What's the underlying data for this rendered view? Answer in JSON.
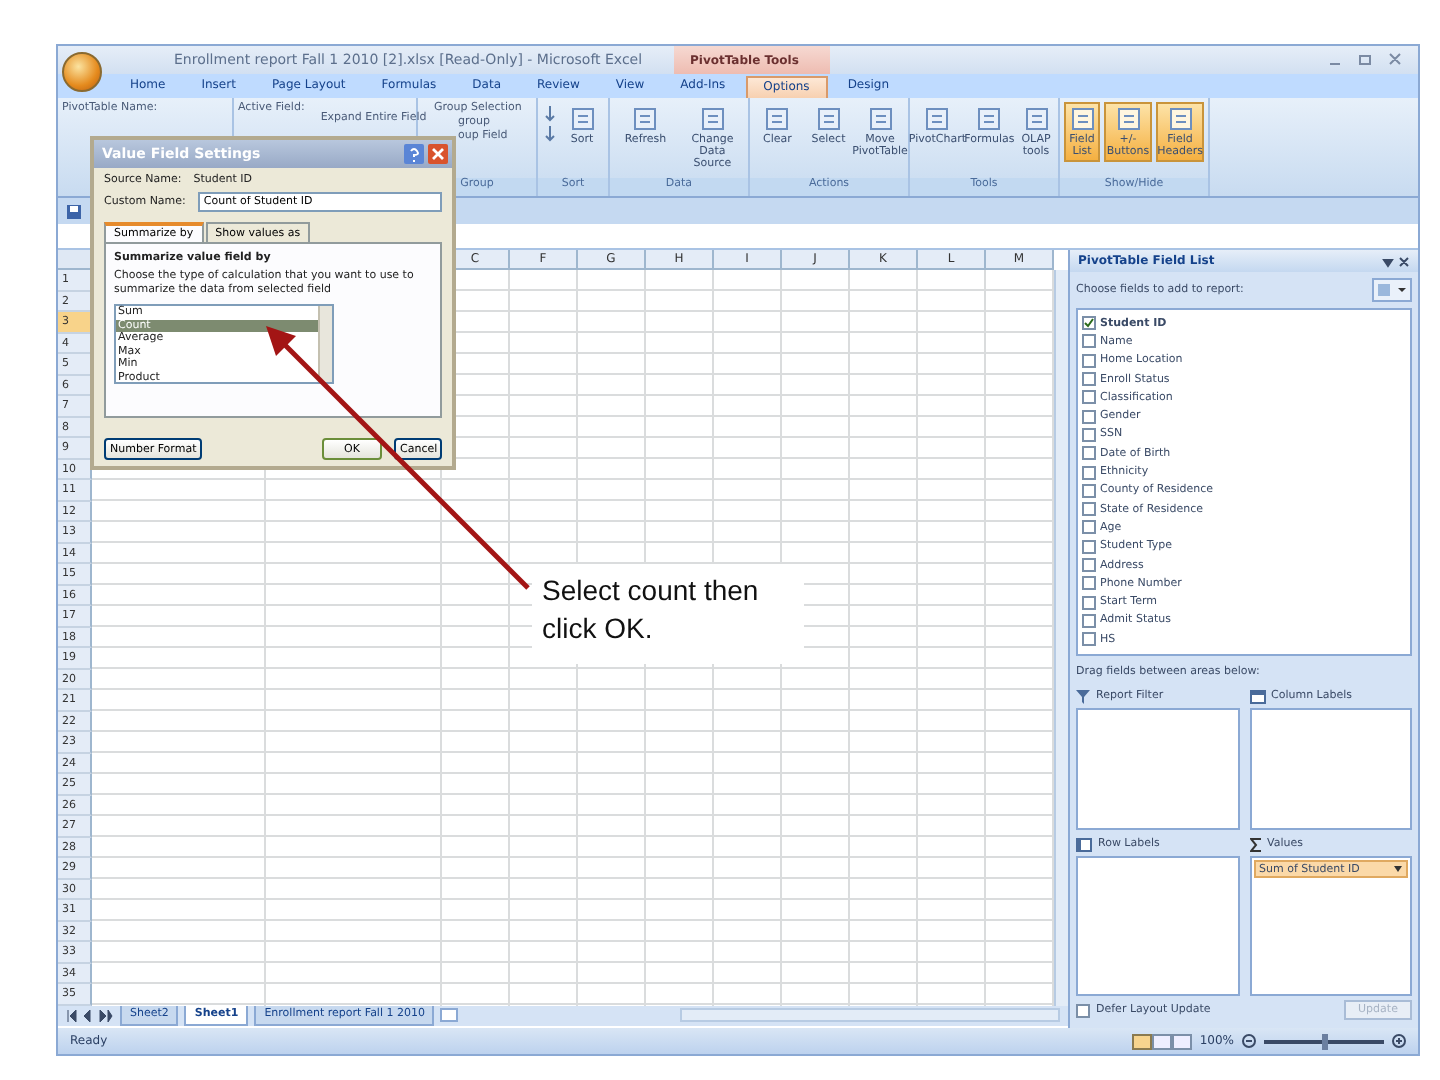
{
  "window": {
    "title": "Enrollment report Fall 1 2010 [2].xlsx [Read-Only] - Microsoft Excel",
    "context_tab": "PivotTable Tools"
  },
  "ribbon_tabs": [
    {
      "label": "Home",
      "selected": false
    },
    {
      "label": "Insert",
      "selected": false
    },
    {
      "label": "Page Layout",
      "selected": false
    },
    {
      "label": "Formulas",
      "selected": false
    },
    {
      "label": "Data",
      "selected": false
    },
    {
      "label": "Review",
      "selected": false
    },
    {
      "label": "View",
      "selected": false
    },
    {
      "label": "Add-Ins",
      "selected": false
    },
    {
      "label": "Options",
      "selected": true
    },
    {
      "label": "Design",
      "selected": false
    }
  ],
  "ribbon": {
    "pivot_name_label": "PivotTable Name:",
    "active_field_label": "Active Field:",
    "expand_label": "Expand Entire Field",
    "group_group": {
      "items": [
        "Group Selection",
        "group",
        "oup Field"
      ],
      "label": "Group"
    },
    "sort_group": {
      "button": "Sort",
      "label": "Sort"
    },
    "groups": [
      {
        "label": "Data",
        "buttons": [
          {
            "label": "Refresh",
            "on": false
          },
          {
            "label": "Change Data Source",
            "on": false
          }
        ]
      },
      {
        "label": "Actions",
        "buttons": [
          {
            "label": "Clear",
            "on": false
          },
          {
            "label": "Select",
            "on": false
          },
          {
            "label": "Move PivotTable",
            "on": false
          }
        ]
      },
      {
        "label": "Tools",
        "buttons": [
          {
            "label": "PivotChart",
            "on": false
          },
          {
            "label": "Formulas",
            "on": false
          },
          {
            "label": "OLAP tools",
            "on": false
          }
        ]
      },
      {
        "label": "Show/Hide",
        "buttons": [
          {
            "label": "Field List",
            "on": true
          },
          {
            "label": "+/- Buttons",
            "on": true
          },
          {
            "label": "Field Headers",
            "on": true
          }
        ]
      }
    ]
  },
  "columns": [
    "C",
    "F",
    "G",
    "H",
    "I",
    "J",
    "K",
    "L",
    "M"
  ],
  "rows": [
    {
      "label": "1",
      "selected": false
    },
    {
      "label": "2",
      "selected": false
    },
    {
      "label": "3",
      "selected": true
    },
    {
      "label": "4",
      "selected": false
    },
    {
      "label": "5",
      "selected": false
    },
    {
      "label": "6",
      "selected": false
    },
    {
      "label": "7",
      "selected": false
    },
    {
      "label": "8",
      "selected": false
    },
    {
      "label": "9",
      "selected": false
    },
    {
      "label": "10",
      "selected": false
    },
    {
      "label": "11",
      "selected": false
    },
    {
      "label": "12",
      "selected": false
    },
    {
      "label": "13",
      "selected": false
    },
    {
      "label": "14",
      "selected": false
    },
    {
      "label": "15",
      "selected": false
    },
    {
      "label": "16",
      "selected": false
    },
    {
      "label": "17",
      "selected": false
    },
    {
      "label": "18",
      "selected": false
    },
    {
      "label": "19",
      "selected": false
    },
    {
      "label": "20",
      "selected": false
    },
    {
      "label": "21",
      "selected": false
    },
    {
      "label": "22",
      "selected": false
    },
    {
      "label": "23",
      "selected": false
    },
    {
      "label": "24",
      "selected": false
    },
    {
      "label": "25",
      "selected": false
    },
    {
      "label": "26",
      "selected": false
    },
    {
      "label": "27",
      "selected": false
    },
    {
      "label": "28",
      "selected": false
    },
    {
      "label": "29",
      "selected": false
    },
    {
      "label": "30",
      "selected": false
    },
    {
      "label": "31",
      "selected": false
    },
    {
      "label": "32",
      "selected": false
    },
    {
      "label": "33",
      "selected": false
    },
    {
      "label": "34",
      "selected": false
    },
    {
      "label": "35",
      "selected": false
    }
  ],
  "sheet_tabs": [
    {
      "label": "Sheet2",
      "selected": false
    },
    {
      "label": "Sheet1",
      "selected": true
    },
    {
      "label": "Enrollment report Fall 1 2010",
      "selected": false
    }
  ],
  "status_bar": {
    "text": "Ready",
    "zoom": "100%",
    "zoom_slider": {
      "level": 0.5
    }
  },
  "dialog": {
    "title": "Value Field Settings",
    "source_label": "Source Name:",
    "source_value": "Student ID",
    "custom_label": "Custom Name:",
    "custom_value": "Count of Student ID",
    "tabs": [
      {
        "label": "Summarize by",
        "selected": true
      },
      {
        "label": "Show values as",
        "selected": false
      }
    ],
    "heading": "Summarize value field by",
    "description": "Choose the type of calculation that you want to use to summarize the data from selected field",
    "functions": [
      {
        "label": "Sum",
        "selected": false
      },
      {
        "label": "Count",
        "selected": true
      },
      {
        "label": "Average",
        "selected": false
      },
      {
        "label": "Max",
        "selected": false
      },
      {
        "label": "Min",
        "selected": false
      },
      {
        "label": "Product",
        "selected": false
      }
    ],
    "buttons": [
      "Number Format",
      "OK",
      "Cancel"
    ]
  },
  "field_list": {
    "title": "PivotTable Field List",
    "prompt": "Choose fields to add to report:",
    "fields": [
      {
        "label": "Student ID",
        "checked": true
      },
      {
        "label": "Name",
        "checked": false
      },
      {
        "label": "Home Location",
        "checked": false
      },
      {
        "label": "Enroll Status",
        "checked": false
      },
      {
        "label": "Classification",
        "checked": false
      },
      {
        "label": "Gender",
        "checked": false
      },
      {
        "label": "SSN",
        "checked": false
      },
      {
        "label": "Date of Birth",
        "checked": false
      },
      {
        "label": "Ethnicity",
        "checked": false
      },
      {
        "label": "County of Residence",
        "checked": false
      },
      {
        "label": "State of Residence",
        "checked": false
      },
      {
        "label": "Age",
        "checked": false
      },
      {
        "label": "Student Type",
        "checked": false
      },
      {
        "label": "Address",
        "checked": false
      },
      {
        "label": "Phone Number",
        "checked": false
      },
      {
        "label": "Start Term",
        "checked": false
      },
      {
        "label": "Admit Status",
        "checked": false
      },
      {
        "label": "HS",
        "checked": false
      }
    ],
    "drag_prompt": "Drag fields between areas below:",
    "areas": [
      {
        "kind": "filter",
        "label": "Report Filter"
      },
      {
        "kind": "columns",
        "label": "Column Labels"
      },
      {
        "kind": "rows",
        "label": "Row Labels"
      },
      {
        "kind": "values",
        "label": "Values",
        "items": [
          "Sum of Student ID"
        ]
      }
    ],
    "defer": {
      "label": "Defer Layout Update",
      "checked": false
    },
    "update": {
      "label": "Update",
      "disabled": true
    }
  },
  "callout": "Select count then click OK."
}
